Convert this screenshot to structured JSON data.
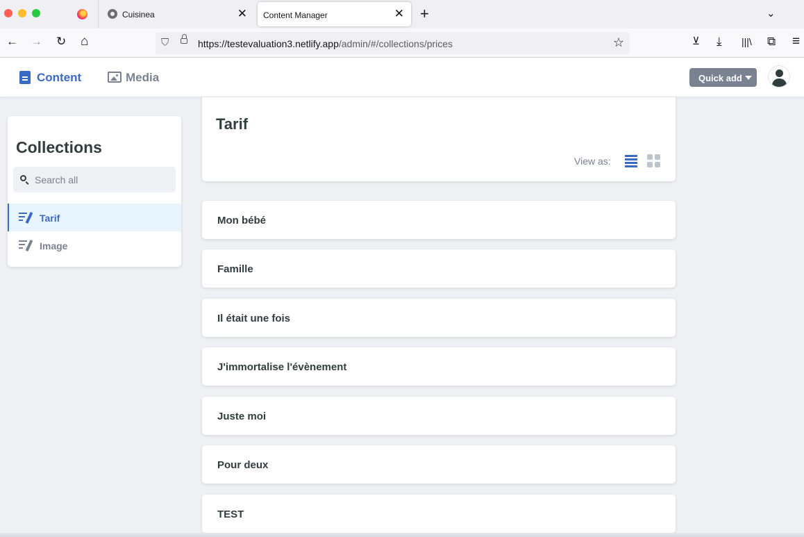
{
  "browser": {
    "tabs": [
      {
        "label": "Cuisinea",
        "active": false
      },
      {
        "label": "Content Manager",
        "active": true
      }
    ],
    "url_host": "https://testevaluation3.netlify.app",
    "url_path": "/admin/#/collections/prices",
    "close_glyph": "✕",
    "new_tab_glyph": "+",
    "chevron_glyph": "⌄",
    "nav": {
      "back": "←",
      "forward": "→",
      "reload": "↻",
      "home": "⌂"
    },
    "toolbar": {
      "pocket": "⊻",
      "downloads": "⤓",
      "library": "|||\\",
      "extensions": "⧉",
      "menu": "≡"
    },
    "shield_glyph": "⛉",
    "star_glyph": "☆"
  },
  "header": {
    "content_label": "Content",
    "media_label": "Media",
    "quick_add_label": "Quick add"
  },
  "sidebar": {
    "title": "Collections",
    "search_placeholder": "Search all",
    "items": [
      {
        "label": "Tarif",
        "active": true
      },
      {
        "label": "Image",
        "active": false
      }
    ]
  },
  "main": {
    "collection_title": "Tarif",
    "view_as_label": "View as:",
    "entries": [
      "Mon bébé",
      "Famille",
      "Il était une fois",
      "J'immortalise l'évènement",
      "Juste moi",
      "Pour deux",
      "TEST"
    ]
  },
  "colors": {
    "accent": "#3a69c7",
    "muted": "#798291",
    "background": "#eff0f4",
    "text": "#313d3e"
  }
}
